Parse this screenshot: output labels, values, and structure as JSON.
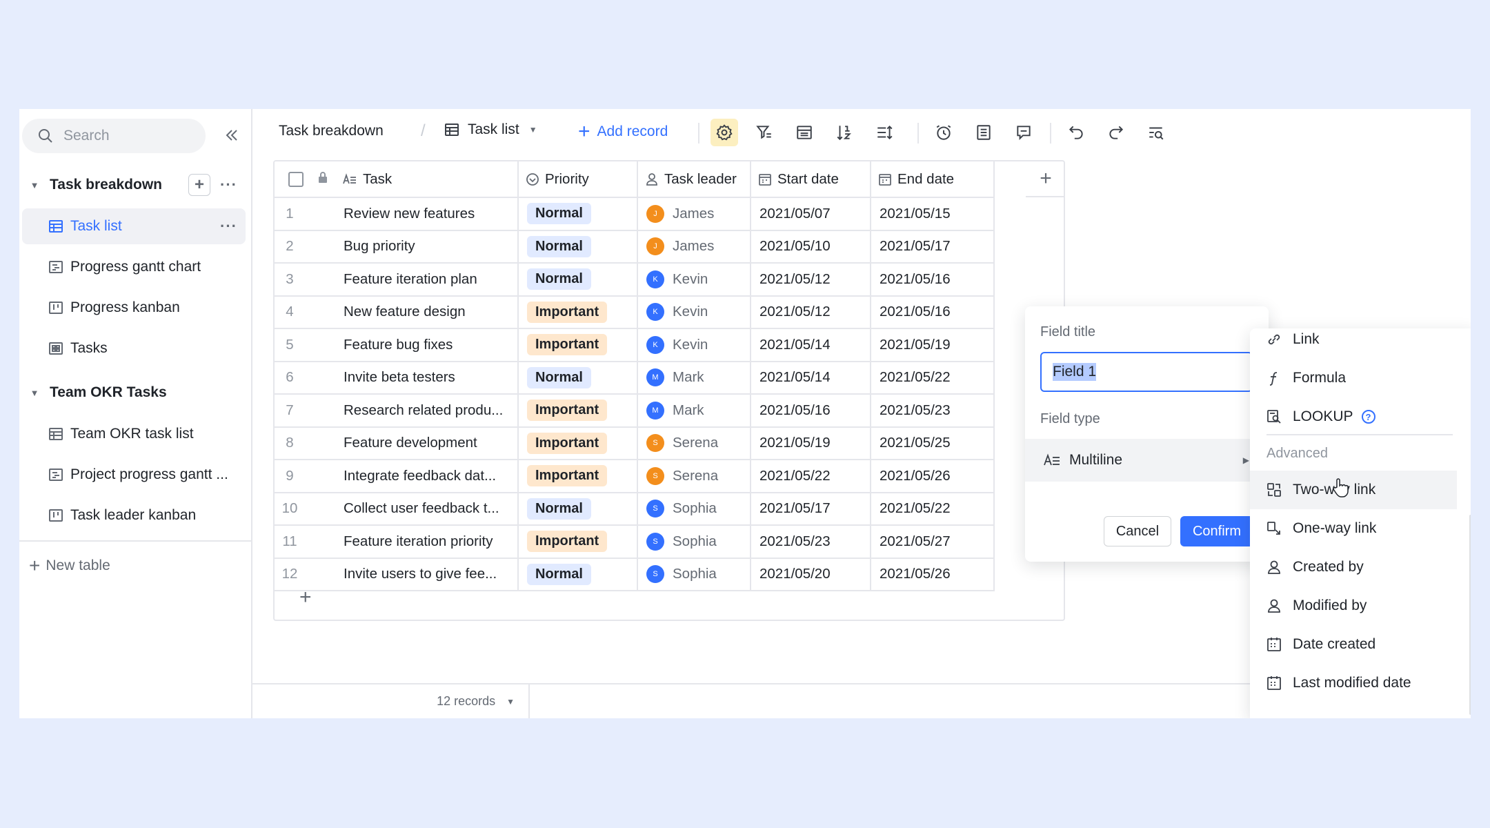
{
  "sidebar": {
    "search_placeholder": "Search",
    "groups": [
      {
        "title": "Task breakdown"
      },
      {
        "title": "Team OKR Tasks"
      }
    ],
    "items": [
      {
        "label": "Task list"
      },
      {
        "label": "Progress gantt chart"
      },
      {
        "label": "Progress kanban"
      },
      {
        "label": "Tasks"
      },
      {
        "label": "Team OKR task list"
      },
      {
        "label": "Project progress gantt ..."
      },
      {
        "label": "Task leader kanban"
      }
    ],
    "new_table": "New table"
  },
  "toolbar": {
    "breadcrumb": "Task breakdown",
    "separator": "/",
    "view_name": "Task list",
    "add_record": "Add record"
  },
  "grid": {
    "columns": [
      "Task",
      "Priority",
      "Task leader",
      "Start date",
      "End date"
    ],
    "rows": [
      {
        "n": "1",
        "task": "Review new features",
        "priority": "Normal",
        "leader": "James",
        "initial": "J",
        "start": "2021/05/07",
        "end": "2021/05/15"
      },
      {
        "n": "2",
        "task": "Bug priority",
        "priority": "Normal",
        "leader": "James",
        "initial": "J",
        "start": "2021/05/10",
        "end": "2021/05/17"
      },
      {
        "n": "3",
        "task": "Feature iteration plan",
        "priority": "Normal",
        "leader": "Kevin",
        "initial": "K",
        "start": "2021/05/12",
        "end": "2021/05/16"
      },
      {
        "n": "4",
        "task": "New feature design",
        "priority": "Important",
        "leader": "Kevin",
        "initial": "K",
        "start": "2021/05/12",
        "end": "2021/05/16"
      },
      {
        "n": "5",
        "task": "Feature bug fixes",
        "priority": "Important",
        "leader": "Kevin",
        "initial": "K",
        "start": "2021/05/14",
        "end": "2021/05/19"
      },
      {
        "n": "6",
        "task": "Invite beta testers",
        "priority": "Normal",
        "leader": "Mark",
        "initial": "M",
        "start": "2021/05/14",
        "end": "2021/05/22"
      },
      {
        "n": "7",
        "task": "Research related produ...",
        "priority": "Important",
        "leader": "Mark",
        "initial": "M",
        "start": "2021/05/16",
        "end": "2021/05/23"
      },
      {
        "n": "8",
        "task": "Feature development",
        "priority": "Important",
        "leader": "Serena",
        "initial": "S",
        "start": "2021/05/19",
        "end": "2021/05/25"
      },
      {
        "n": "9",
        "task": "Integrate feedback dat...",
        "priority": "Important",
        "leader": "Serena",
        "initial": "S",
        "start": "2021/05/22",
        "end": "2021/05/26"
      },
      {
        "n": "10",
        "task": "Collect user feedback t...",
        "priority": "Normal",
        "leader": "Sophia",
        "initial": "S",
        "start": "2021/05/17",
        "end": "2021/05/22"
      },
      {
        "n": "11",
        "task": "Feature iteration priority",
        "priority": "Important",
        "leader": "Sophia",
        "initial": "S",
        "start": "2021/05/23",
        "end": "2021/05/27"
      },
      {
        "n": "12",
        "task": "Invite users to give fee...",
        "priority": "Normal",
        "leader": "Sophia",
        "initial": "S",
        "start": "2021/05/20",
        "end": "2021/05/26"
      }
    ],
    "avatar_colors": {
      "James": "#F38E1C",
      "Kevin": "#3370FF",
      "Mark": "#3370FF",
      "Serena": "#F38E1C",
      "Sophia": "#3370FF"
    }
  },
  "footer": {
    "records": "12 records"
  },
  "field_popup": {
    "title_label": "Field title",
    "title_value": "Field 1",
    "type_label": "Field type",
    "type_value": "Multiline",
    "cancel": "Cancel",
    "confirm": "Confirm"
  },
  "type_menu": {
    "items_top": [
      "Link",
      "Formula",
      "LOOKUP"
    ],
    "section": "Advanced",
    "items_advanced": [
      "Two-way link",
      "One-way link",
      "Created by",
      "Modified by",
      "Date created",
      "Last modified date"
    ]
  },
  "colors": {
    "accent": "#3370FF",
    "background": "#E6EDFD",
    "normal_tag": "#E1EAFF",
    "important_tag": "#FEE7CD"
  }
}
